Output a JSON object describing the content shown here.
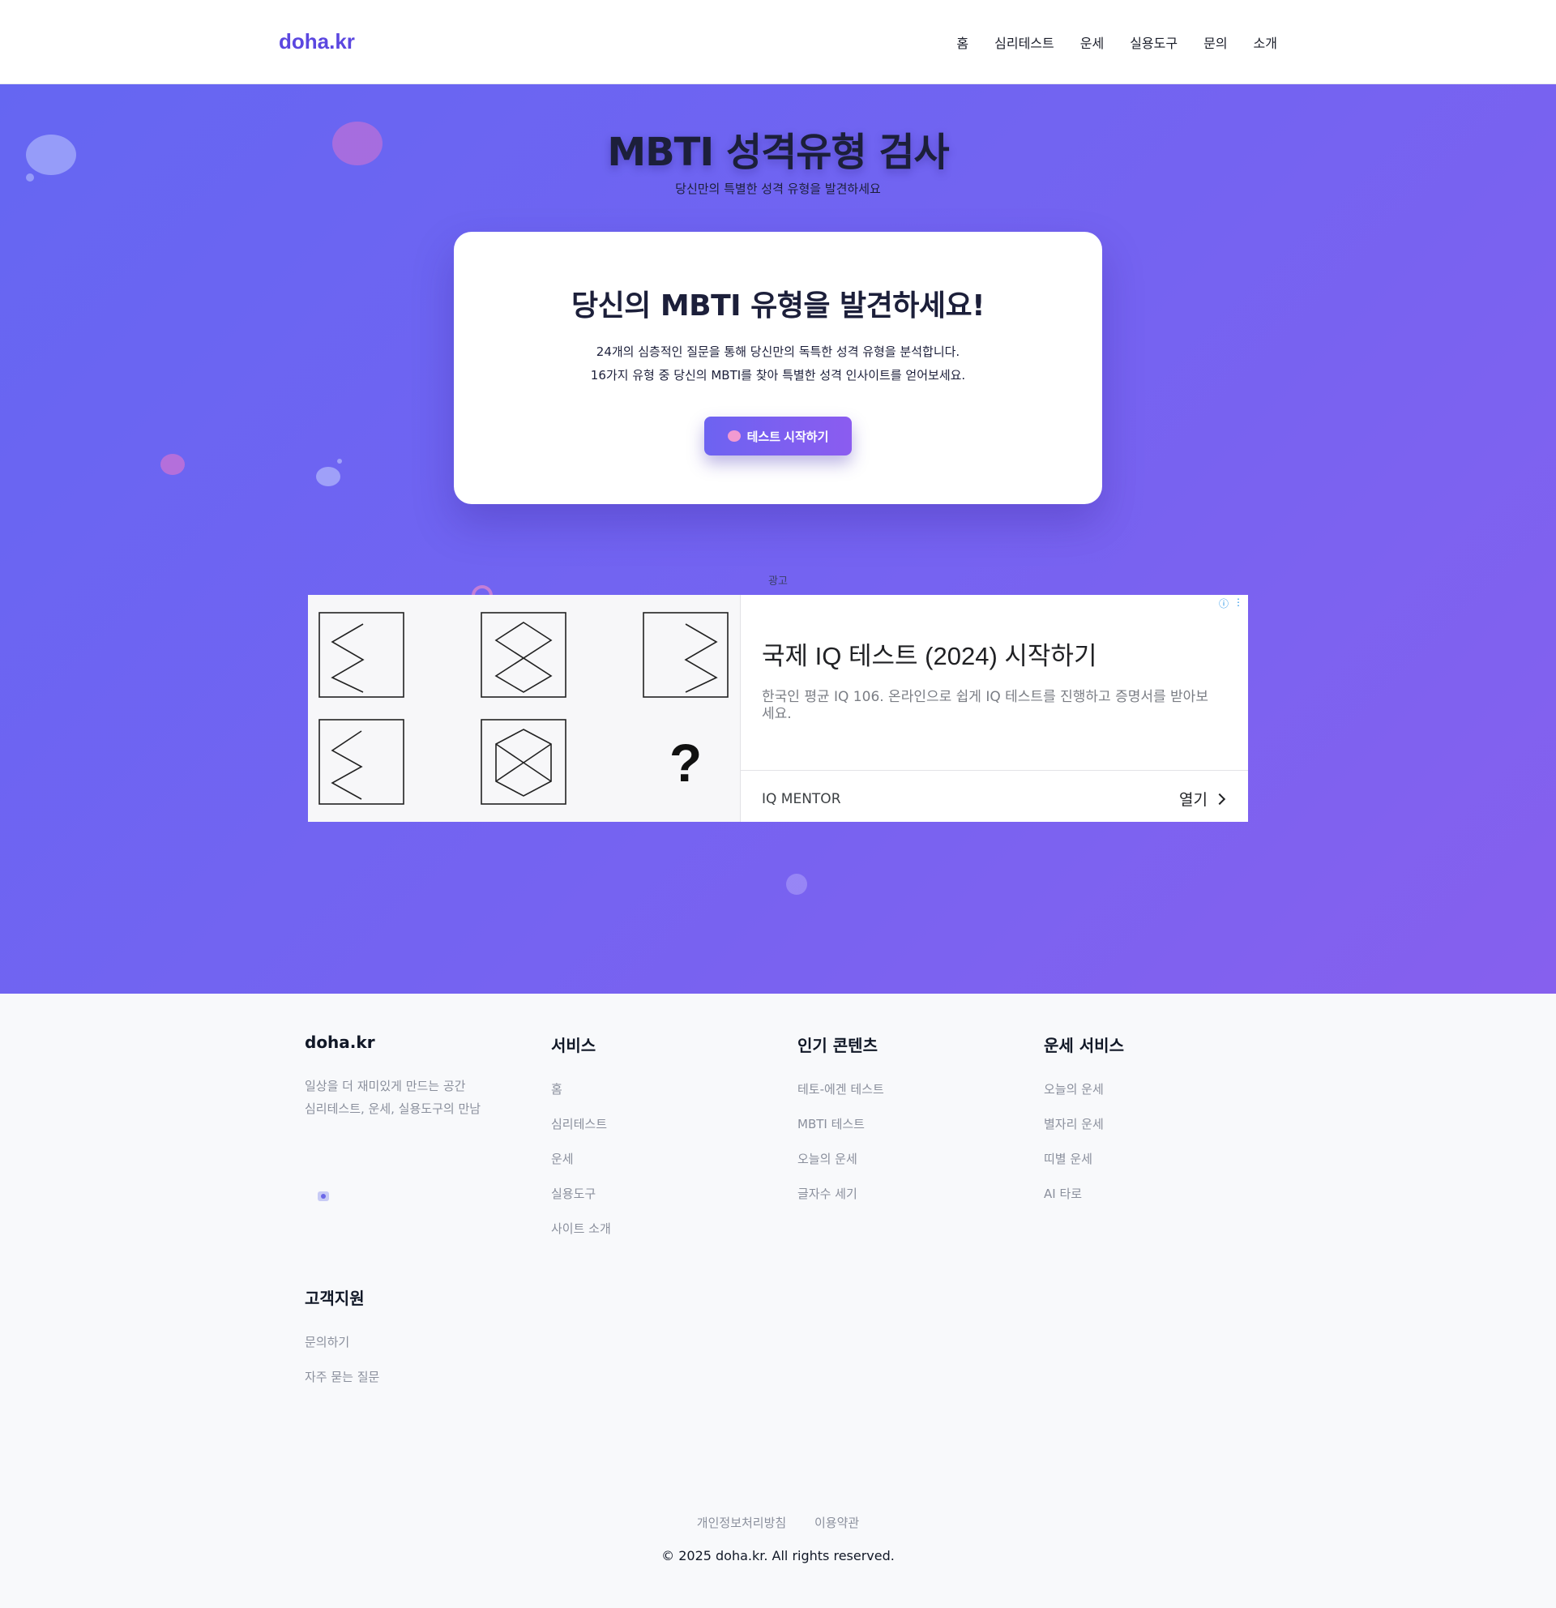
{
  "header": {
    "logo": "doha.kr",
    "nav": [
      "홈",
      "심리테스트",
      "운세",
      "실용도구",
      "문의",
      "소개"
    ]
  },
  "hero": {
    "title": "MBTI 성격유형 검사",
    "subtitle": "당신만의 특별한 성격 유형을 발견하세요"
  },
  "card": {
    "title": "당신의 MBTI 유형을 발견하세요!",
    "desc_line1": "24개의 심층적인 질문을 통해 당신만의 독특한 성격 유형을 분석합니다.",
    "desc_line2": "16가지 유형 중 당신의 MBTI를 찾아 특별한 성격 인사이트를 얻어보세요.",
    "cta_label": "테스트 시작하기",
    "cta_icon": "brain-icon"
  },
  "ad": {
    "label": "광고",
    "headline": "국제 IQ 테스트 (2024) 시작하기",
    "body": "한국인 평균 IQ 106. 온라인으로 쉽게 IQ 테스트를 진행하고 증명서를 받아보세요.",
    "advertiser": "IQ MENTOR",
    "open_label": "열기",
    "puzzle_question": "?",
    "info_icon": "ⓘ",
    "menu_icon": "⋮"
  },
  "footer": {
    "brand": "doha.kr",
    "desc_line1": "일상을 더 재미있게 만드는 공간",
    "desc_line2": "심리테스트, 운세, 실용도구의 만남",
    "columns": [
      {
        "title": "서비스",
        "items": [
          "홈",
          "심리테스트",
          "운세",
          "실용도구",
          "사이트 소개"
        ]
      },
      {
        "title": "인기 콘텐츠",
        "items": [
          "테토-에겐 테스트",
          "MBTI 테스트",
          "오늘의 운세",
          "글자수 세기"
        ]
      },
      {
        "title": "운세 서비스",
        "items": [
          "오늘의 운세",
          "별자리 운세",
          "띠별 운세",
          "AI 타로"
        ]
      },
      {
        "title": "고객지원",
        "items": [
          "문의하기",
          "자주 묻는 질문"
        ]
      }
    ],
    "bottom_links": [
      "개인정보처리방침",
      "이용약관"
    ],
    "copyright": "© 2025 doha.kr. All rights reserved."
  },
  "colors": {
    "accent": "#5b47e0",
    "hero_gradient_start": "#6566f2",
    "hero_gradient_end": "#8660ee",
    "card_bg": "#ffffff",
    "footer_bg": "#f8f9fb"
  }
}
